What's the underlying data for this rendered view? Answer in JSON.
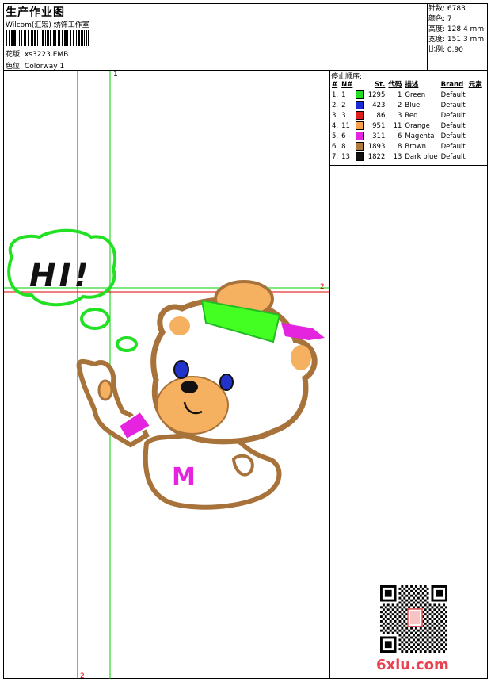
{
  "header": {
    "title": "生产作业图",
    "company": "Wilcom(汇宏) 绣饰工作室",
    "pattern_label": "花版:",
    "pattern_value": "xs3223.EMB",
    "colorway_label": "色位:",
    "colorway_value": "Colorway 1"
  },
  "specs": [
    {
      "label": "针数:",
      "value": "6783"
    },
    {
      "label": "颜色:",
      "value": "7"
    },
    {
      "label": "高度:",
      "value": "128.4 mm"
    },
    {
      "label": "宽度:",
      "value": "151.3 mm"
    },
    {
      "label": "比例:",
      "value": "0.90"
    }
  ],
  "stop_sequence_label": "停止顺序:",
  "color_table": {
    "headers": [
      "#",
      "N#",
      "St.",
      "代码",
      "描述",
      "Brand",
      "元素"
    ],
    "rows": [
      {
        "idx": "1.",
        "n": "1",
        "st": "1295",
        "code": "1",
        "desc": "Green",
        "brand": "Default",
        "color": "#22dd22"
      },
      {
        "idx": "2.",
        "n": "2",
        "st": "423",
        "code": "2",
        "desc": "Blue",
        "brand": "Default",
        "color": "#1a2ad6"
      },
      {
        "idx": "3.",
        "n": "3",
        "st": "86",
        "code": "3",
        "desc": "Red",
        "brand": "Default",
        "color": "#e01d1d"
      },
      {
        "idx": "4.",
        "n": "11",
        "st": "951",
        "code": "11",
        "desc": "Orange",
        "brand": "Default",
        "color": "#f7a24a"
      },
      {
        "idx": "5.",
        "n": "6",
        "st": "311",
        "code": "6",
        "desc": "Magenta",
        "brand": "Default",
        "color": "#e524e0"
      },
      {
        "idx": "6.",
        "n": "8",
        "st": "1893",
        "code": "8",
        "desc": "Brown",
        "brand": "Default",
        "color": "#b07a3a"
      },
      {
        "idx": "7.",
        "n": "13",
        "st": "1822",
        "code": "13",
        "desc": "Dark blue",
        "brand": "Default",
        "color": "#111111"
      }
    ]
  },
  "guides": {
    "label_1": "1",
    "label_2_right": "2",
    "label_2_bottom": "2"
  },
  "design": {
    "bubble_text": "HI!",
    "shirt_letter": "M"
  },
  "watermark": "6xiu.com",
  "colors": {
    "green_guide": "#00cc00",
    "red_guide": "#dd0000"
  }
}
